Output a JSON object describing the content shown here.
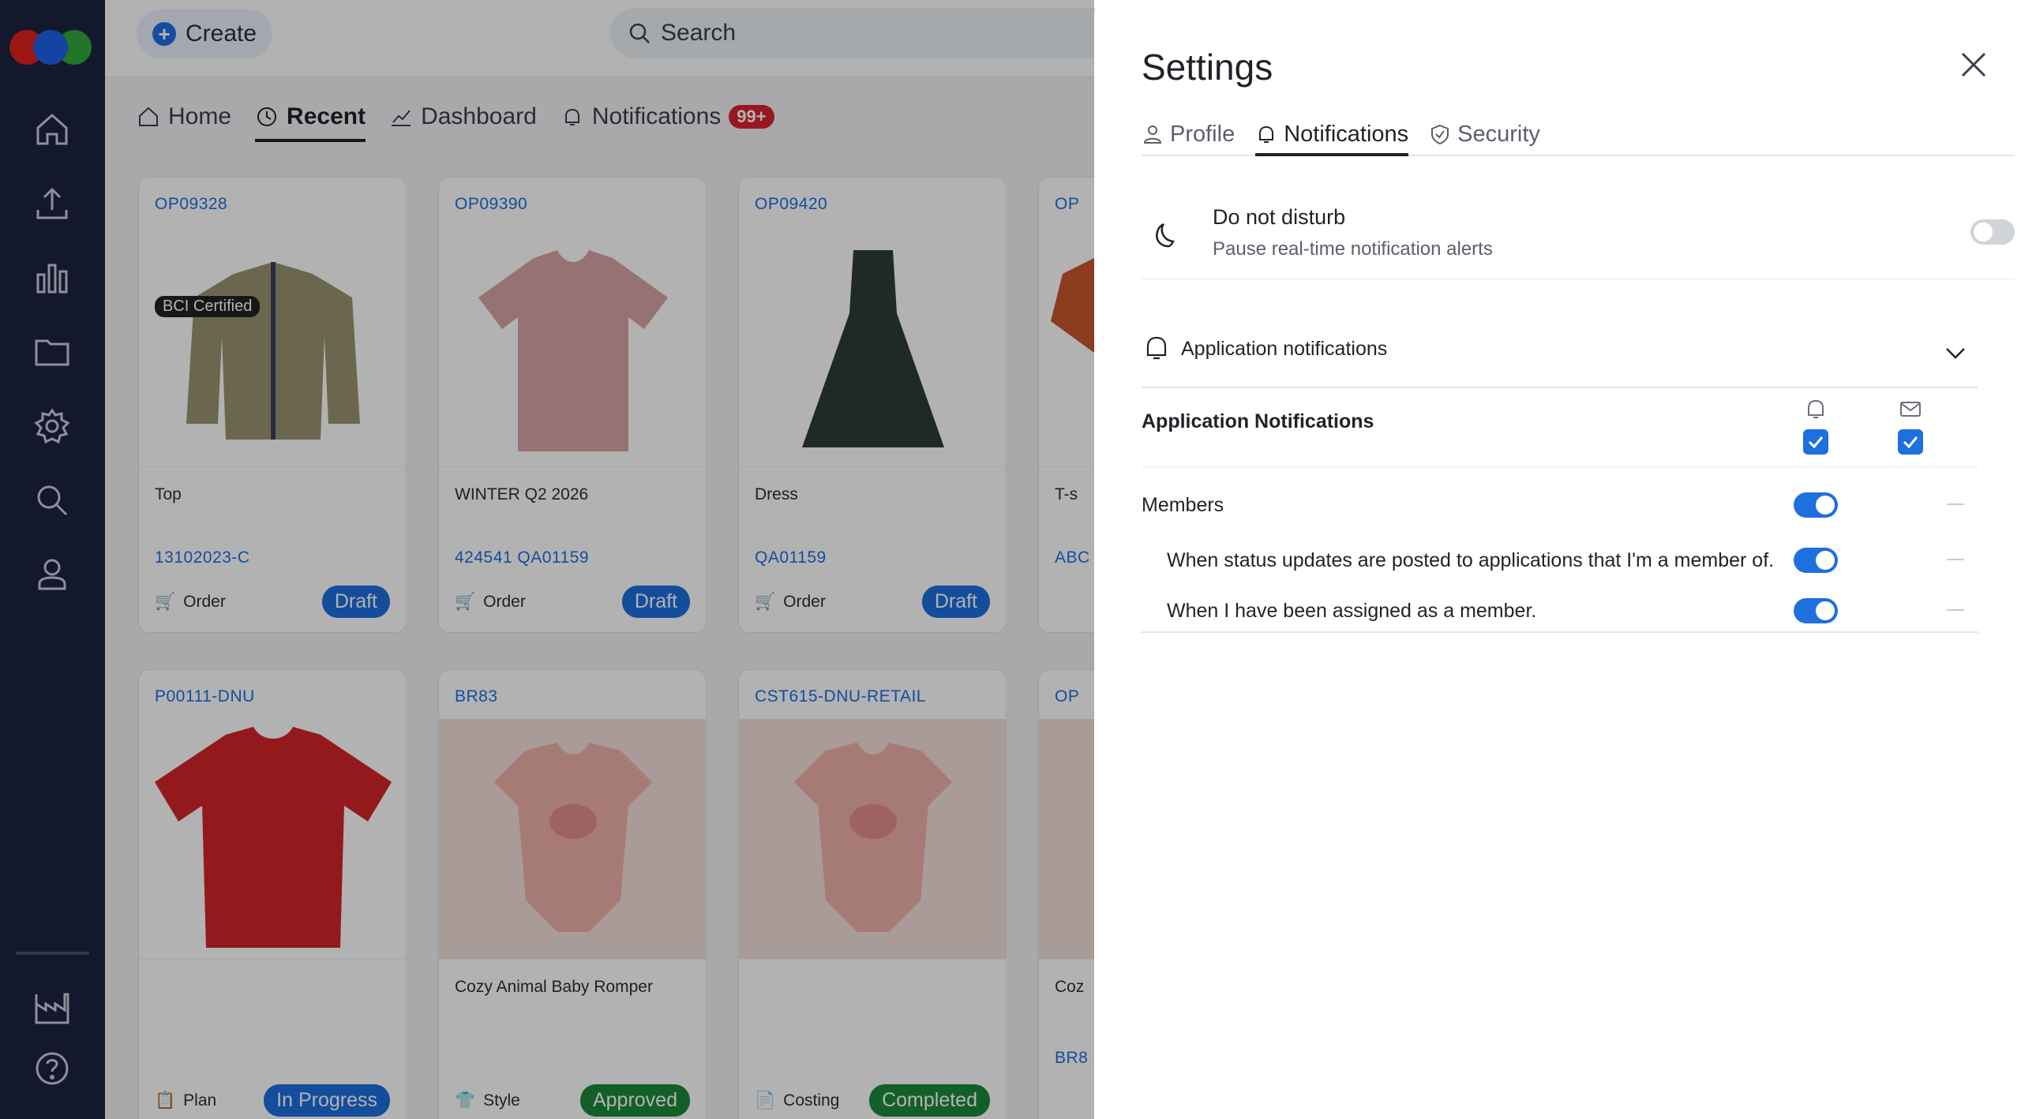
{
  "app": {
    "create_label": "Create",
    "search_placeholder": "Search"
  },
  "nav": {
    "tabs": [
      {
        "label": "Home",
        "icon": "home-icon"
      },
      {
        "label": "Recent",
        "icon": "history-icon",
        "active": true
      },
      {
        "label": "Dashboard",
        "icon": "chart-icon"
      },
      {
        "label": "Notifications",
        "icon": "bell-icon",
        "badge": "99+"
      }
    ]
  },
  "sidebar": {
    "icons": [
      "home-icon",
      "upload-icon",
      "bar-chart-icon",
      "folder-icon",
      "gear-icon",
      "search-icon",
      "user-icon",
      "factory-icon",
      "help-icon"
    ]
  },
  "cards": [
    {
      "code": "OP09328",
      "title": "Top",
      "ref": "13102023-C",
      "kind": "Order",
      "status": "Draft",
      "cert": "BCI Certified"
    },
    {
      "code": "OP09390",
      "title": "WINTER Q2 2026",
      "ref": "424541 QA01159",
      "kind": "Order",
      "status": "Draft"
    },
    {
      "code": "OP09420",
      "title": "Dress",
      "ref": "QA01159",
      "kind": "Order",
      "status": "Draft"
    },
    {
      "code": "OP",
      "title": "T-s",
      "ref": "ABC",
      "kind": "",
      "status": ""
    },
    {
      "code": "P00111-DNU",
      "title": "",
      "ref": "",
      "kind": "Plan",
      "status": "In Progress"
    },
    {
      "code": "BR83",
      "title": "Cozy Animal Baby Romper",
      "ref": "",
      "kind": "Style",
      "status": "Approved"
    },
    {
      "code": "CST615-DNU-RETAIL",
      "title": "",
      "ref": "",
      "kind": "Costing",
      "status": "Completed"
    },
    {
      "code": "OP",
      "title": "Coz",
      "ref": "BR8",
      "kind": "",
      "status": ""
    }
  ],
  "settings": {
    "title": "Settings",
    "tabs": [
      {
        "label": "Profile",
        "icon": "user-icon"
      },
      {
        "label": "Notifications",
        "icon": "bell-icon",
        "active": true
      },
      {
        "label": "Security",
        "icon": "shield-icon"
      }
    ],
    "dnd": {
      "title": "Do not disturb",
      "description": "Pause real-time notification alerts",
      "enabled": false
    },
    "app_notifications_section": "Application notifications",
    "app_notifications_row": {
      "label": "Application Notifications",
      "in_app": true,
      "email": true
    },
    "members": {
      "label": "Members",
      "enabled": true,
      "items": [
        {
          "label": "When status updates are posted to applications that I'm a member of.",
          "enabled": true
        },
        {
          "label": "When I have been assigned as a member.",
          "enabled": true
        }
      ]
    }
  },
  "colors": {
    "sidebar": "#1c2340",
    "accent": "#1e6fe0",
    "badge": "#d9232e",
    "success": "#1b8a3a"
  }
}
